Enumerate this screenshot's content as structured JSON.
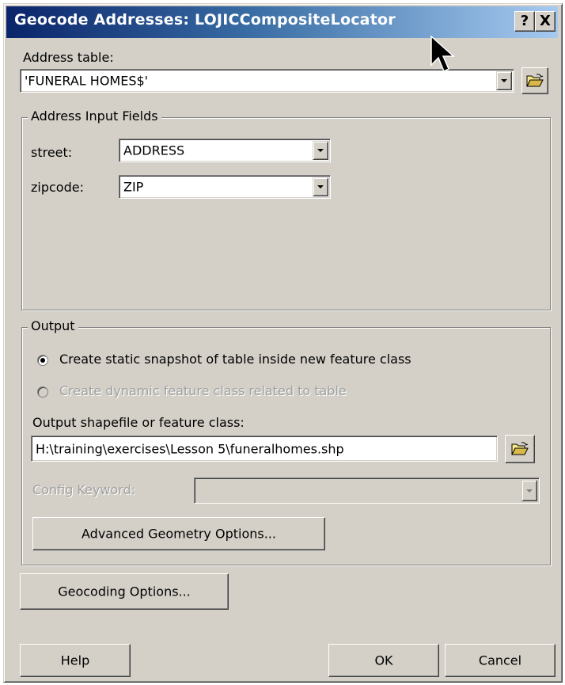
{
  "window": {
    "title": "Geocode Addresses:  LOJICCompositeLocator",
    "help_button": "?",
    "close_button": "X"
  },
  "address_table": {
    "label": "Address table:",
    "value": "'FUNERAL HOMES$'",
    "browse_icon": "folder-open-icon"
  },
  "input_fields": {
    "legend": "Address Input Fields",
    "street_label": "street:",
    "street_value": "ADDRESS",
    "zipcode_label": "zipcode:",
    "zipcode_value": "ZIP"
  },
  "output": {
    "legend": "Output",
    "option_static": "Create static snapshot of table inside new feature class",
    "option_static_selected": true,
    "option_dynamic": "Create dynamic feature class related to table",
    "option_dynamic_enabled": false,
    "shapefile_label": "Output shapefile or feature class:",
    "shapefile_value": "H:\\training\\exercises\\Lesson 5\\funeralhomes.shp",
    "config_label": "Config Keyword:",
    "config_value": "",
    "advanced_button": "Advanced Geometry Options..."
  },
  "footer": {
    "geocoding_options_button": "Geocoding Options...",
    "help_button": "Help",
    "ok_button": "OK",
    "cancel_button": "Cancel"
  },
  "colors": {
    "titlebar_start": "#0a246a",
    "titlebar_end": "#a6caf0",
    "dialog_face": "#d4d0c8"
  }
}
